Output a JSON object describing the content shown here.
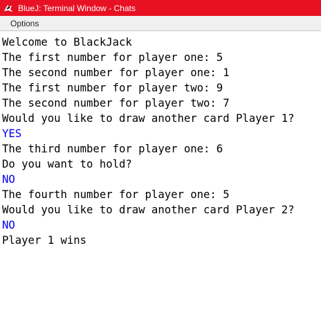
{
  "window": {
    "title": "BlueJ: Terminal Window - Chats",
    "accent": "#e81123"
  },
  "menubar": {
    "options_label": "Options"
  },
  "terminal": {
    "input_color": "#0000ee",
    "lines": [
      {
        "text": "Welcome to BlackJack",
        "kind": "output"
      },
      {
        "text": "The first number for player one: 5",
        "kind": "output"
      },
      {
        "text": "The second number for player one: 1",
        "kind": "output"
      },
      {
        "text": "The first number for player two: 9",
        "kind": "output"
      },
      {
        "text": "The second number for player two: 7",
        "kind": "output"
      },
      {
        "text": "Would you like to draw another card Player 1?",
        "kind": "output"
      },
      {
        "text": "YES",
        "kind": "input"
      },
      {
        "text": "The third number for player one: 6",
        "kind": "output"
      },
      {
        "text": "Do you want to hold?",
        "kind": "output"
      },
      {
        "text": "NO",
        "kind": "input"
      },
      {
        "text": "The fourth number for player one: 5",
        "kind": "output"
      },
      {
        "text": "Would you like to draw another card Player 2?",
        "kind": "output"
      },
      {
        "text": "NO",
        "kind": "input"
      },
      {
        "text": "Player 1 wins",
        "kind": "output"
      }
    ]
  }
}
